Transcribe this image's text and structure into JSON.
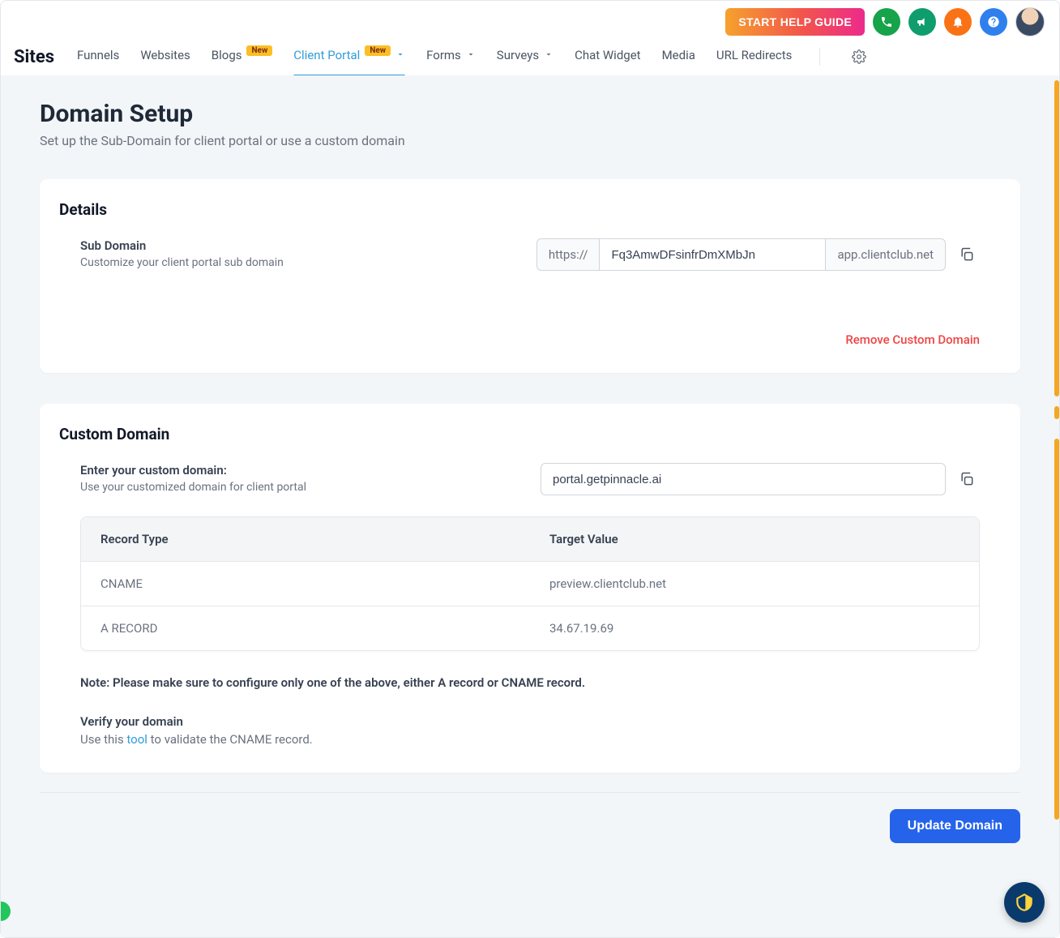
{
  "topbar": {
    "help_guide": "START HELP GUIDE"
  },
  "brand": "Sites",
  "nav": {
    "funnels": "Funnels",
    "websites": "Websites",
    "blogs": "Blogs",
    "blogs_badge": "New",
    "client_portal": "Client Portal",
    "client_portal_badge": "New",
    "forms": "Forms",
    "surveys": "Surveys",
    "chat_widget": "Chat Widget",
    "media": "Media",
    "url_redirects": "URL Redirects"
  },
  "page": {
    "title": "Domain Setup",
    "subtitle": "Set up the Sub-Domain for client portal or use a custom domain"
  },
  "details": {
    "heading": "Details",
    "sub_label": "Sub Domain",
    "sub_hint": "Customize your client portal sub domain",
    "proto": "https://",
    "subdomain_value": "Fq3AmwDFsinfrDmXMbJn",
    "base_domain": "app.clientclub.net",
    "remove_link": "Remove Custom Domain"
  },
  "custom": {
    "heading": "Custom Domain",
    "label": "Enter your custom domain:",
    "hint": "Use your customized domain for client portal",
    "value": "portal.getpinnacle.ai",
    "table": {
      "col1": "Record Type",
      "col2": "Target Value",
      "rows": [
        {
          "type": "CNAME",
          "value": "preview.clientclub.net"
        },
        {
          "type": "A RECORD",
          "value": "34.67.19.69"
        }
      ]
    },
    "note": "Note: Please make sure to configure only one of the above, either A record or CNAME record.",
    "verify_head": "Verify your domain",
    "verify_pre": "Use this ",
    "verify_link": "tool",
    "verify_post": " to validate the CNAME record."
  },
  "footer": {
    "update_btn": "Update Domain"
  }
}
